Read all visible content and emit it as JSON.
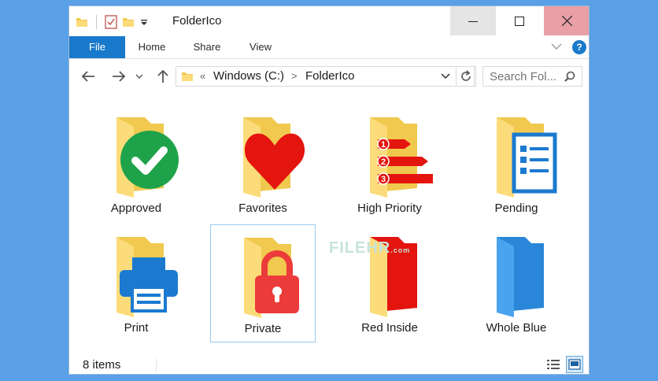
{
  "window": {
    "title": "FolderIco",
    "accent": "#1979ca"
  },
  "ribbon": {
    "tabs": [
      {
        "label": "File"
      },
      {
        "label": "Home"
      },
      {
        "label": "Share"
      },
      {
        "label": "View"
      }
    ],
    "help_label": "?"
  },
  "address": {
    "overflow": "«",
    "crumbs": [
      "Windows (C:)",
      "FolderIco"
    ],
    "separator": ">"
  },
  "search": {
    "placeholder": "Search Fol..."
  },
  "items": [
    {
      "label": "Approved",
      "icon": "approved-folder-icon"
    },
    {
      "label": "Favorites",
      "icon": "favorites-folder-icon"
    },
    {
      "label": "High Priority",
      "icon": "high-priority-folder-icon",
      "markers": [
        "1",
        "2",
        "3"
      ]
    },
    {
      "label": "Pending",
      "icon": "pending-folder-icon"
    },
    {
      "label": "Print",
      "icon": "print-folder-icon"
    },
    {
      "label": "Private",
      "icon": "private-folder-icon",
      "selected": true
    },
    {
      "label": "Red Inside",
      "icon": "red-inside-folder-icon"
    },
    {
      "label": "Whole Blue",
      "icon": "whole-blue-folder-icon"
    }
  ],
  "status": {
    "count": "8 items"
  },
  "watermark": {
    "text": "FILEHR",
    "sub": ".com"
  }
}
